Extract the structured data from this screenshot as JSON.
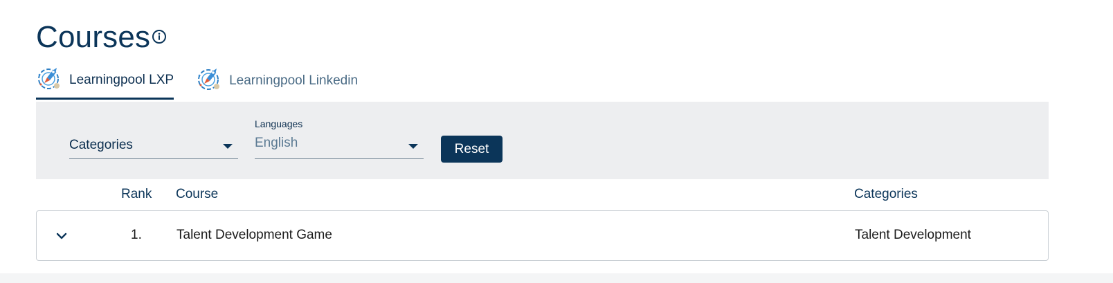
{
  "header": {
    "title": "Courses"
  },
  "tabs": [
    {
      "label": "Learningpool LXP",
      "active": true
    },
    {
      "label": "Learningpool Linkedin",
      "active": false
    }
  ],
  "filters": {
    "categories": {
      "value": "Categories"
    },
    "languages": {
      "label": "Languages",
      "value": "English"
    },
    "reset_label": "Reset"
  },
  "table": {
    "columns": {
      "rank": "Rank",
      "course": "Course",
      "categories": "Categories"
    },
    "rows": [
      {
        "rank": "1.",
        "course": "Talent Development Game",
        "categories": "Talent Development"
      }
    ]
  },
  "colors": {
    "primary": "#0b3559",
    "filter_bg": "#edeef0",
    "muted_text": "#4a6b85"
  },
  "icons": {
    "info": "info-circle-icon",
    "tab": "rocket-logo-icon",
    "dropdown": "caret-down-icon",
    "expand": "chevron-down-icon"
  }
}
